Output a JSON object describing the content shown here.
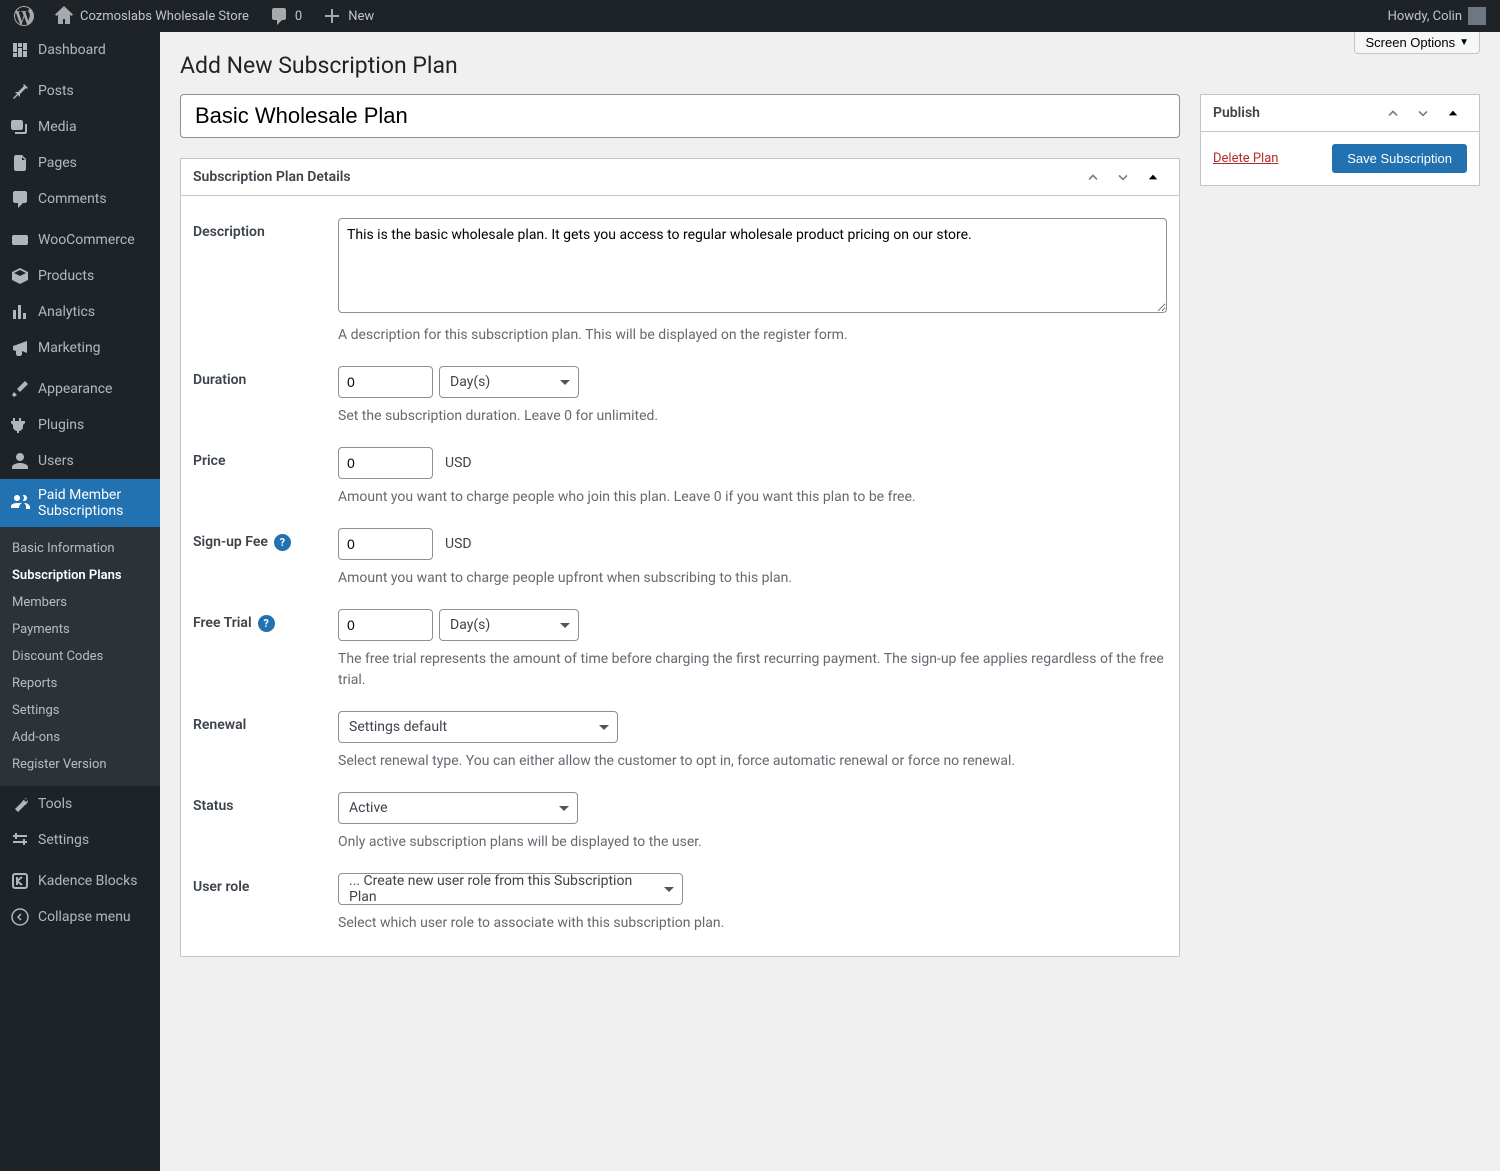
{
  "adminbar": {
    "site_name": "Cozmoslabs Wholesale Store",
    "comments_count": "0",
    "new_label": "New",
    "howdy": "Howdy, Colin"
  },
  "screen_options_label": "Screen Options",
  "page_title": "Add New Subscription Plan",
  "title_value": "Basic Wholesale Plan",
  "sidebar": {
    "items": [
      {
        "label": "Dashboard"
      },
      {
        "label": "Posts"
      },
      {
        "label": "Media"
      },
      {
        "label": "Pages"
      },
      {
        "label": "Comments"
      },
      {
        "label": "WooCommerce"
      },
      {
        "label": "Products"
      },
      {
        "label": "Analytics"
      },
      {
        "label": "Marketing"
      },
      {
        "label": "Appearance"
      },
      {
        "label": "Plugins"
      },
      {
        "label": "Users"
      },
      {
        "label": "Paid Member Subscriptions"
      },
      {
        "label": "Tools"
      },
      {
        "label": "Settings"
      },
      {
        "label": "Kadence Blocks"
      },
      {
        "label": "Collapse menu"
      }
    ],
    "submenu": [
      "Basic Information",
      "Subscription Plans",
      "Members",
      "Payments",
      "Discount Codes",
      "Reports",
      "Settings",
      "Add-ons",
      "Register Version"
    ]
  },
  "details_box": {
    "title": "Subscription Plan Details",
    "description": {
      "label": "Description",
      "value": "This is the basic wholesale plan. It gets you access to regular wholesale product pricing on our store.",
      "help": "A description for this subscription plan. This will be displayed on the register form."
    },
    "duration": {
      "label": "Duration",
      "value": "0",
      "unit": "Day(s)",
      "help": "Set the subscription duration. Leave 0 for unlimited."
    },
    "price": {
      "label": "Price",
      "value": "0",
      "currency": "USD",
      "help": "Amount you want to charge people who join this plan. Leave 0 if you want this plan to be free."
    },
    "signup_fee": {
      "label": "Sign-up Fee",
      "value": "0",
      "currency": "USD",
      "help": "Amount you want to charge people upfront when subscribing to this plan."
    },
    "free_trial": {
      "label": "Free Trial",
      "value": "0",
      "unit": "Day(s)",
      "help": "The free trial represents the amount of time before charging the first recurring payment. The sign-up fee applies regardless of the free trial."
    },
    "renewal": {
      "label": "Renewal",
      "value": "Settings default",
      "help": "Select renewal type. You can either allow the customer to opt in, force automatic renewal or force no renewal."
    },
    "status": {
      "label": "Status",
      "value": "Active",
      "help": "Only active subscription plans will be displayed to the user."
    },
    "user_role": {
      "label": "User role",
      "value": "... Create new user role from this Subscription Plan",
      "help": "Select which user role to associate with this subscription plan."
    }
  },
  "publish_box": {
    "title": "Publish",
    "delete_label": "Delete Plan",
    "save_label": "Save Subscription"
  }
}
